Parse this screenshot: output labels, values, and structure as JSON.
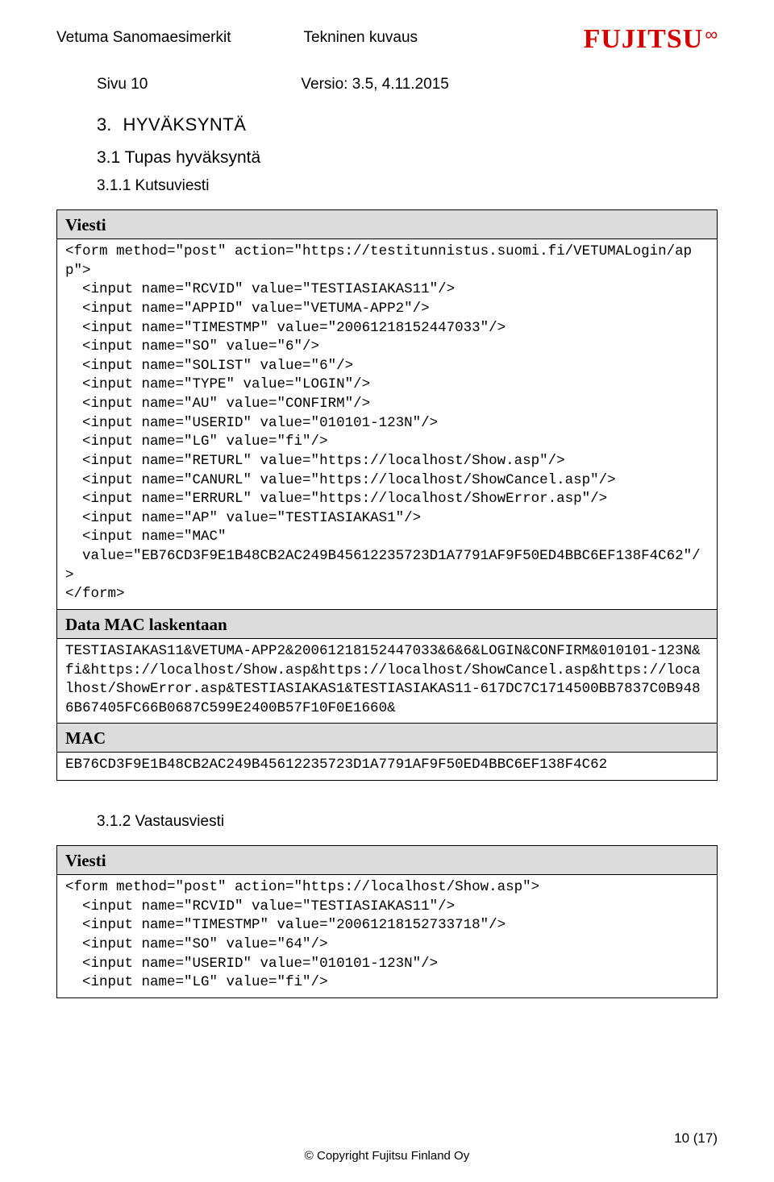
{
  "header": {
    "title_left": "Vetuma Sanomaesimerkit",
    "title_right": "Tekninen kuvaus",
    "logo_text": "FUJITSU",
    "logo_mark": "∞"
  },
  "meta": {
    "page_label": "Sivu 10",
    "version_label": "Versio: 3.5, 4.11.2015"
  },
  "sections": {
    "s3_num": "3.",
    "s3_title": "HYVÄKSYNTÄ",
    "s31_num": "3.1",
    "s31_title": "Tupas hyväksyntä",
    "s311_num": "3.1.1",
    "s311_title": "Kutsuviesti",
    "s312_num": "3.1.2",
    "s312_title": "Vastausviesti"
  },
  "box1": {
    "label_viesti": "Viesti",
    "content_viesti": "<form method=\"post\" action=\"https://testitunnistus.suomi.fi/VETUMALogin/app\">\n  <input name=\"RCVID\" value=\"TESTIASIAKAS11\"/>\n  <input name=\"APPID\" value=\"VETUMA-APP2\"/>\n  <input name=\"TIMESTMP\" value=\"20061218152447033\"/>\n  <input name=\"SO\" value=\"6\"/>\n  <input name=\"SOLIST\" value=\"6\"/>\n  <input name=\"TYPE\" value=\"LOGIN\"/>\n  <input name=\"AU\" value=\"CONFIRM\"/>\n  <input name=\"USERID\" value=\"010101-123N\"/>\n  <input name=\"LG\" value=\"fi\"/>\n  <input name=\"RETURL\" value=\"https://localhost/Show.asp\"/>\n  <input name=\"CANURL\" value=\"https://localhost/ShowCancel.asp\"/>\n  <input name=\"ERRURL\" value=\"https://localhost/ShowError.asp\"/>\n  <input name=\"AP\" value=\"TESTIASIAKAS1\"/>\n  <input name=\"MAC\"\n  value=\"EB76CD3F9E1B48CB2AC249B45612235723D1A7791AF9F50ED4BBC6EF138F4C62\"/>\n</form>",
    "label_data_mac": "Data MAC laskentaan",
    "content_data_mac": "TESTIASIAKAS11&VETUMA-APP2&20061218152447033&6&6&LOGIN&CONFIRM&010101-123N&fi&https://localhost/Show.asp&https://localhost/ShowCancel.asp&https://localhost/ShowError.asp&TESTIASIAKAS1&TESTIASIAKAS11-617DC7C1714500BB7837C0B9486B67405FC66B0687C599E2400B57F10F0E1660&",
    "label_mac": "MAC",
    "content_mac": "EB76CD3F9E1B48CB2AC249B45612235723D1A7791AF9F50ED4BBC6EF138F4C62"
  },
  "box2": {
    "label_viesti": "Viesti",
    "content_viesti": "<form method=\"post\" action=\"https://localhost/Show.asp\">\n  <input name=\"RCVID\" value=\"TESTIASIAKAS11\"/>\n  <input name=\"TIMESTMP\" value=\"20061218152733718\"/>\n  <input name=\"SO\" value=\"64\"/>\n  <input name=\"USERID\" value=\"010101-123N\"/>\n  <input name=\"LG\" value=\"fi\"/>"
  },
  "footer": {
    "copyright": "© Copyright Fujitsu Finland Oy",
    "pagenum": "10 (17)"
  }
}
